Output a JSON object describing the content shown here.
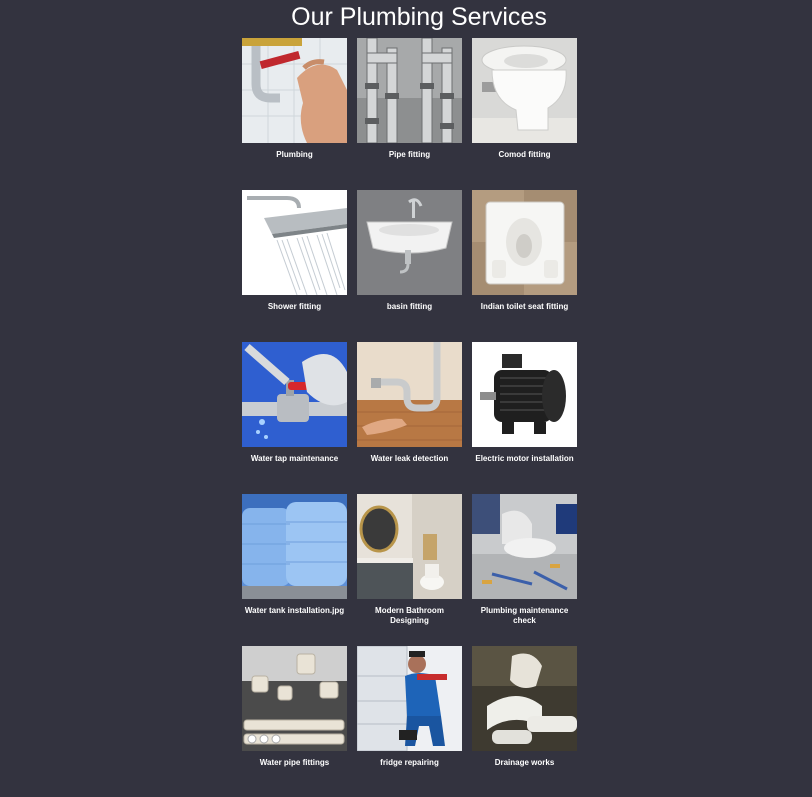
{
  "page": {
    "title": "Our Plumbing Services"
  },
  "services": [
    {
      "label": "Plumbing",
      "icon": "plumbing-image"
    },
    {
      "label": "Pipe fitting",
      "icon": "pipe-fitting-image"
    },
    {
      "label": "Comod fitting",
      "icon": "comod-fitting-image"
    },
    {
      "label": "Shower fitting",
      "icon": "shower-fitting-image"
    },
    {
      "label": "basin fitting",
      "icon": "basin-fitting-image"
    },
    {
      "label": "Indian toilet seat fitting",
      "icon": "indian-toilet-image"
    },
    {
      "label": "Water tap maintenance",
      "icon": "water-tap-image"
    },
    {
      "label": "Water leak detection",
      "icon": "water-leak-image"
    },
    {
      "label": "Electric motor installation",
      "icon": "electric-motor-image"
    },
    {
      "label": "Water tank installation.jpg",
      "icon": "water-tank-image"
    },
    {
      "label": "Modern Bathroom Designing",
      "icon": "bathroom-design-image"
    },
    {
      "label": "Plumbing maintenance check",
      "icon": "plumbing-check-image"
    },
    {
      "label": "Water pipe fittings",
      "icon": "pipe-fittings-image"
    },
    {
      "label": "fridge repairing",
      "icon": "fridge-repair-image"
    },
    {
      "label": "Drainage works",
      "icon": "drainage-image"
    }
  ],
  "colors": {
    "background": "#33333f",
    "text": "#ffffff"
  }
}
